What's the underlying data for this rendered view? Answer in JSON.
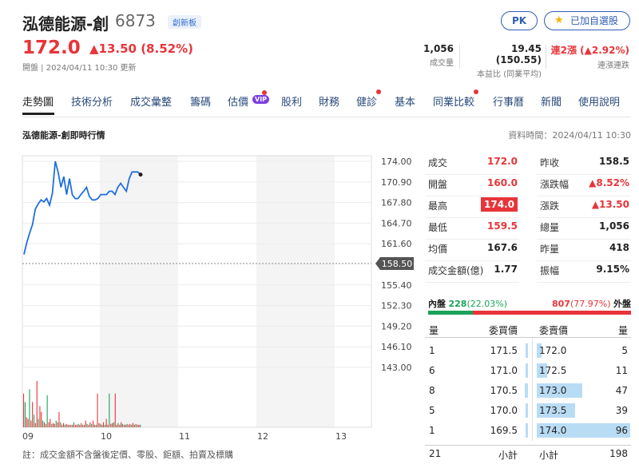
{
  "stock": {
    "name": "泓德能源-創",
    "code": "6873",
    "board": "創新板",
    "price": "172.0",
    "change": "▲13.50 (8.52%)",
    "status": "開盤 | 2024/04/11 10:30 更新"
  },
  "buttons": {
    "pk": "PK",
    "watchlist": "已加自選股"
  },
  "stats": [
    {
      "value": "1,056",
      "label": "成交量"
    },
    {
      "value": "19.45 (150.55)",
      "label": "本益比 (同業平均)"
    },
    {
      "value": "連2漲 (▲2.92%)",
      "label": "連漲連跌"
    }
  ],
  "tabs": [
    "走勢圖",
    "技術分析",
    "成交彙整",
    "籌碼",
    "估價",
    "股利",
    "財務",
    "健診",
    "基本",
    "同業比較",
    "行事曆",
    "新聞",
    "使用說明"
  ],
  "vip_badge": "VIP",
  "section": {
    "title": "泓德能源-創即時行情",
    "time": "資料時間：2024/04/11 10:30"
  },
  "chart_data": {
    "type": "line",
    "x_ticks": [
      "09",
      "10",
      "11",
      "12",
      "13"
    ],
    "y_ticks": [
      "174.00",
      "170.90",
      "167.80",
      "164.70",
      "161.60",
      "158.50",
      "155.40",
      "152.30",
      "149.20",
      "146.10",
      "143.00"
    ],
    "ylim": [
      143.0,
      174.0
    ],
    "reference": "158.50",
    "series": [
      {
        "values": [
          160.0,
          161.8,
          163.2,
          164.5,
          166.8,
          167.6,
          168.2,
          167.9,
          168.4,
          167.4,
          169.2,
          174.0,
          172.4,
          170.1,
          171.7,
          169.0,
          171.4,
          169.0,
          168.4,
          168.4,
          169.0,
          169.5,
          170.1,
          168.7,
          168.2,
          168.2,
          168.4,
          169.0,
          169.0,
          169.0,
          169.5,
          169.5,
          169.0,
          170.1,
          170.7,
          170.1,
          169.5,
          171.4,
          172.4,
          172.4,
          172.4,
          172.0
        ],
        "last": 172.0
      }
    ],
    "volume": [
      40,
      30,
      12,
      10,
      45,
      8,
      30,
      15,
      5,
      55,
      10,
      25,
      18,
      8,
      6,
      4,
      38,
      6,
      10,
      4,
      5,
      4,
      8,
      6,
      18,
      6,
      3,
      5,
      3,
      4,
      3,
      3,
      3,
      3,
      6,
      3,
      3,
      4,
      3,
      5,
      3,
      3,
      8,
      4,
      3,
      6,
      4,
      8,
      3,
      3,
      40,
      5,
      4,
      3,
      6,
      3,
      10,
      3,
      40,
      4,
      5,
      6,
      40,
      3,
      5,
      3,
      6,
      4,
      3,
      3,
      4,
      3,
      4,
      3,
      5,
      3,
      4,
      3,
      3,
      3
    ]
  },
  "quote_left": [
    {
      "label": "成交",
      "value": "172.0",
      "style": "red"
    },
    {
      "label": "開盤",
      "value": "160.0",
      "style": "red"
    },
    {
      "label": "最高",
      "value": "174.0",
      "style": "badge"
    },
    {
      "label": "最低",
      "value": "159.5",
      "style": "red"
    },
    {
      "label": "均價",
      "value": "167.6",
      "style": "plain"
    },
    {
      "label": "成交金額(億)",
      "value": "1.77",
      "style": "plain"
    }
  ],
  "quote_right": [
    {
      "label": "昨收",
      "value": "158.5",
      "style": "plain"
    },
    {
      "label": "漲跌幅",
      "value": "▲8.52%",
      "style": "red"
    },
    {
      "label": "漲跌",
      "value": "▲13.50",
      "style": "red"
    },
    {
      "label": "總量",
      "value": "1,056",
      "style": "plain"
    },
    {
      "label": "昨量",
      "value": "418",
      "style": "plain"
    },
    {
      "label": "振幅",
      "value": "9.15%",
      "style": "plain"
    }
  ],
  "inout": {
    "in_label": "內盤",
    "in_value": "228",
    "in_pct_text": "(22.03%)",
    "out_value": "807",
    "out_pct_text": "(77.97%)",
    "out_label": "外盤",
    "in_fraction": 0.2203
  },
  "orderbook": {
    "headers": [
      "量",
      "委買價",
      "委賣價",
      "量"
    ],
    "rows": [
      {
        "bid_qty": "1",
        "bid_price": "171.5",
        "ask_price": "172.0",
        "ask_qty": "5"
      },
      {
        "bid_qty": "6",
        "bid_price": "171.0",
        "ask_price": "172.5",
        "ask_qty": "11"
      },
      {
        "bid_qty": "8",
        "bid_price": "170.5",
        "ask_price": "173.0",
        "ask_qty": "47"
      },
      {
        "bid_qty": "5",
        "bid_price": "170.0",
        "ask_price": "173.5",
        "ask_qty": "39"
      },
      {
        "bid_qty": "1",
        "bid_price": "169.5",
        "ask_price": "174.0",
        "ask_qty": "96"
      }
    ],
    "bid_bar_fractions": [
      0.01,
      0.06,
      0.08,
      0.05,
      0.01
    ],
    "ask_bar_fractions": [
      0.05,
      0.11,
      0.49,
      0.41,
      1.0
    ],
    "footer": {
      "bid_total": "21",
      "bid_label": "小計",
      "ask_label": "小計",
      "ask_total": "198"
    }
  },
  "note": "註：成交金額不含盤後定價、零股、鉅額、拍賣及標購",
  "colors": {
    "up": "#e8343a",
    "down": "#1aa25b",
    "line": "#1f6fde",
    "link": "#2a4a7a"
  }
}
